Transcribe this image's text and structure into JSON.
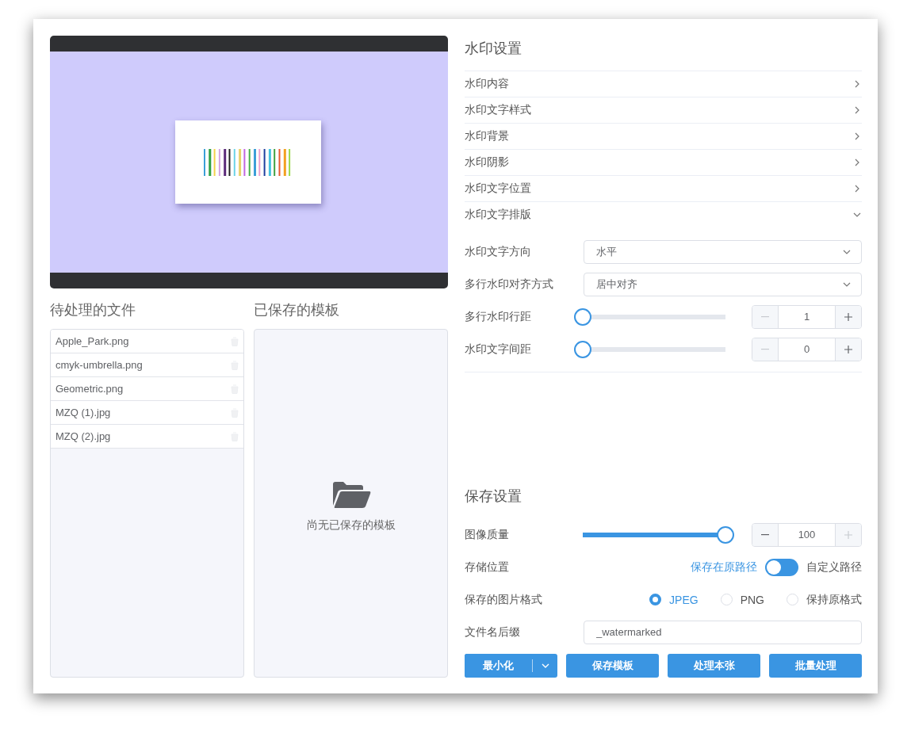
{
  "pending_files": {
    "title": "待处理的文件",
    "items": [
      "Apple_Park.png",
      "cmyk-umbrella.png",
      "Geometric.png",
      "MZQ (1).jpg",
      "MZQ (2).jpg"
    ]
  },
  "templates": {
    "title": "已保存的模板",
    "empty_text": "尚无已保存的模板"
  },
  "watermark_settings": {
    "title": "水印设置",
    "sections": [
      {
        "label": "水印内容",
        "expanded": false
      },
      {
        "label": "水印文字样式",
        "expanded": false
      },
      {
        "label": "水印背景",
        "expanded": false
      },
      {
        "label": "水印阴影",
        "expanded": false
      },
      {
        "label": "水印文字位置",
        "expanded": false
      },
      {
        "label": "水印文字排版",
        "expanded": true,
        "fields": [
          {
            "kind": "select",
            "label": "水印文字方向",
            "value": "水平"
          },
          {
            "kind": "select",
            "label": "多行水印对齐方式",
            "value": "居中对齐"
          },
          {
            "kind": "slider",
            "label": "多行水印行距",
            "level": 0,
            "value": "1",
            "decrement_disabled": true,
            "increment_disabled": false
          },
          {
            "kind": "slider",
            "label": "水印文字间距",
            "level": 0,
            "value": "0",
            "decrement_disabled": true,
            "increment_disabled": false
          }
        ]
      }
    ]
  },
  "save_settings": {
    "title": "保存设置",
    "quality": {
      "label": "图像质量",
      "level": 1,
      "value": "100",
      "decrement_disabled": false,
      "increment_disabled": true
    },
    "location": {
      "label": "存储位置",
      "left_option": "保存在原路径",
      "right_option": "自定义路径",
      "on": false
    },
    "format": {
      "label": "保存的图片格式",
      "options": [
        {
          "label": "JPEG",
          "selected": true
        },
        {
          "label": "PNG",
          "selected": false
        },
        {
          "label": "保持原格式",
          "selected": false
        }
      ]
    },
    "suffix": {
      "label": "文件名后缀",
      "value": "_watermarked"
    }
  },
  "buttons": [
    {
      "kind": "split",
      "label": "最小化"
    },
    {
      "kind": "plain",
      "label": "保存模板"
    },
    {
      "kind": "plain",
      "label": "处理本张"
    },
    {
      "kind": "plain",
      "label": "批量处理"
    }
  ]
}
